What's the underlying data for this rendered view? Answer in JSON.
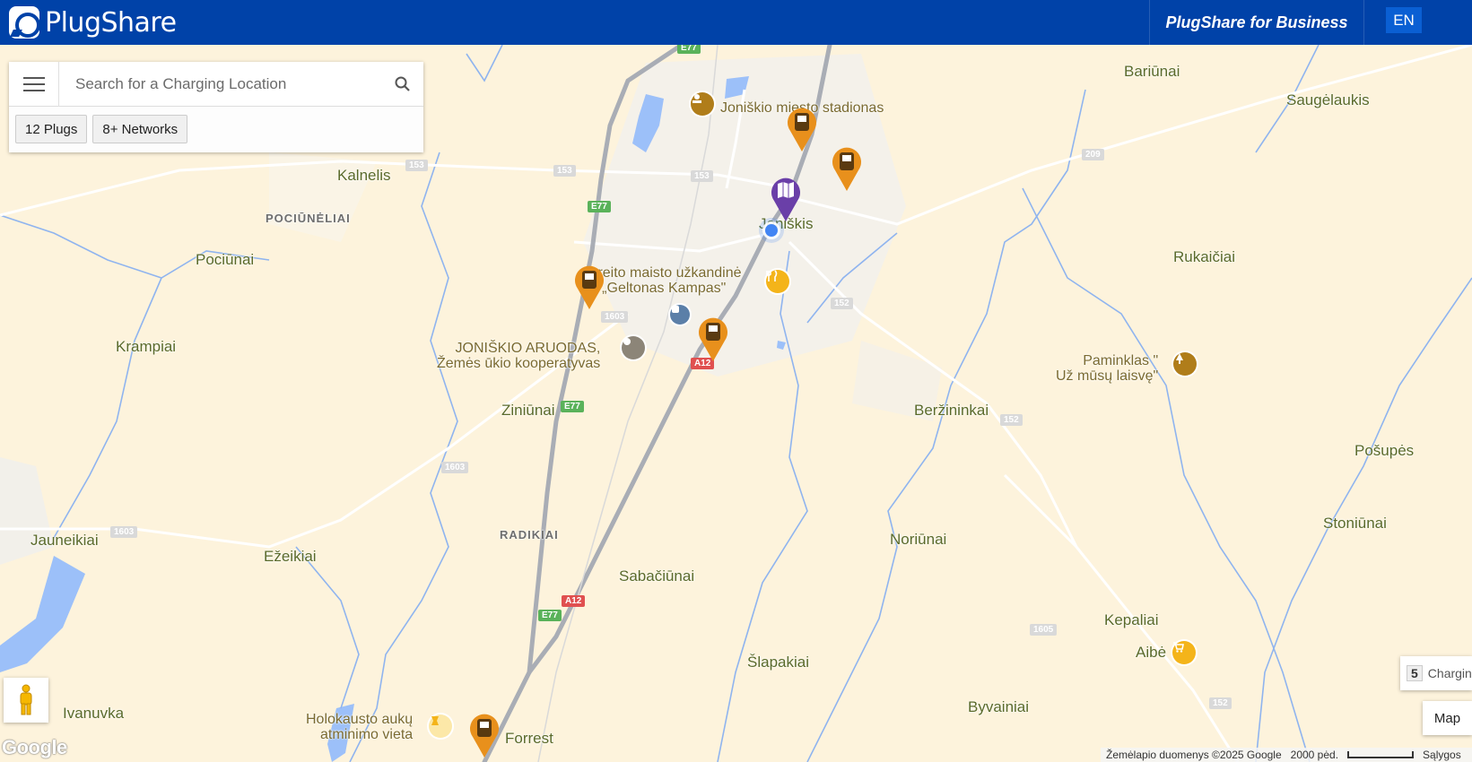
{
  "header": {
    "logo_text": "PlugShare",
    "business_link": "PlugShare for Business",
    "language": "EN"
  },
  "search": {
    "placeholder": "Search for a Charging Location",
    "filters": [
      "12 Plugs",
      "8+ Networks"
    ]
  },
  "map": {
    "places": [
      "Bariūnai",
      "Saugėlaukis",
      "Kalnelis",
      "POCIŪNĖLIAI",
      "Pociūnai",
      "Joniškis",
      "Rukaičiai",
      "Krampiai",
      "Beržininkai",
      "Ziniūnai",
      "Pošupės",
      "Stoniūnai",
      "RADIKIAI",
      "Jauneikiai",
      "Ežeikiai",
      "Noriūnai",
      "Sabačiūnai",
      "Kepaliai",
      "Šlapakiai",
      "Byvainiai",
      "Ivanuvka",
      "Forrest",
      "Aibė"
    ],
    "pois": {
      "stadium": "Joniškio miesto stadionas",
      "restaurant_line1": "Greito maisto užkandinė",
      "restaurant_line2": "„Geltonas Kampas\"",
      "coop_line1": "JONIŠKIO ARUODAS,",
      "coop_line2": "Žemės ūkio kooperatyvas",
      "monument_line1": "Paminklas \"",
      "monument_line2": "Už mūsų laisvę\"",
      "holocaust_line1": "Holokausto aukų",
      "holocaust_line2": "atminimo vieta"
    },
    "road_numbers": [
      "E77",
      "153",
      "153",
      "153",
      "E77",
      "1603",
      "152",
      "A12",
      "E77",
      "152",
      "1603",
      "1603",
      "A12",
      "E77",
      "209",
      "1605",
      "152"
    ],
    "colors": {
      "land": "#fdf3dc",
      "water": "#9cc0f9",
      "charger_pin": "#e8901c",
      "map_pin": "#6a3fa8",
      "header": "#0042a8"
    }
  },
  "controls": {
    "charging_count": "5",
    "charging_label": "Charging",
    "map_type": "Map",
    "google": "Google",
    "attribution": "Žemėlapio duomenys ©2025 Google",
    "scale": "2000 pėd.",
    "terms": "Sąlygos"
  }
}
